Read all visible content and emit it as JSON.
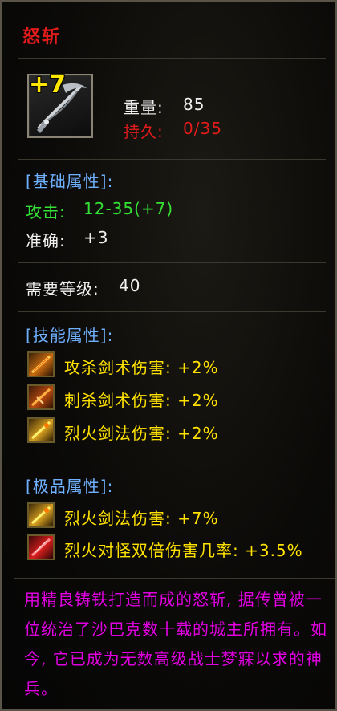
{
  "item": {
    "name": "怒斩",
    "enhance": "+7",
    "icon": "weapon-blade-icon",
    "weight_label": "重量:",
    "weight_value": "85",
    "durability_label": "持久:",
    "durability_value": "0/35"
  },
  "base": {
    "header": "[基础属性]:",
    "attack_label": "攻击:",
    "attack_value": "12-35(+7)",
    "accuracy_label": "准确:",
    "accuracy_value": "+3"
  },
  "requirement": {
    "label": "需要等级:",
    "value": "40"
  },
  "skills": {
    "header": "[技能属性]:",
    "items": [
      {
        "text": "攻杀剑术伤害: +2%",
        "icon": "skill-attack-slash-icon"
      },
      {
        "text": "刺杀剑术伤害: +2%",
        "icon": "skill-thrust-icon"
      },
      {
        "text": "烈火剑法伤害: +2%",
        "icon": "skill-fire-sword-icon"
      }
    ]
  },
  "extreme": {
    "header": "[极品属性]:",
    "items": [
      {
        "text": "烈火剑法伤害: +7%",
        "icon": "skill-fire-sword-icon"
      },
      {
        "text": "烈火对怪双倍伤害几率: +3.5%",
        "icon": "skill-fire-double-icon"
      }
    ]
  },
  "description": "用精良铸铁打造而成的怒斩, 据传曾被一位统治了沙巴克数十载的城主所拥有。如今, 它已成为无数高级战士梦寐以求的神兵。",
  "colors": {
    "title": "#e21b1b",
    "section": "#6fb0ff",
    "attack": "#35e035",
    "skill": "#ffe200",
    "description": "#e000e0"
  }
}
